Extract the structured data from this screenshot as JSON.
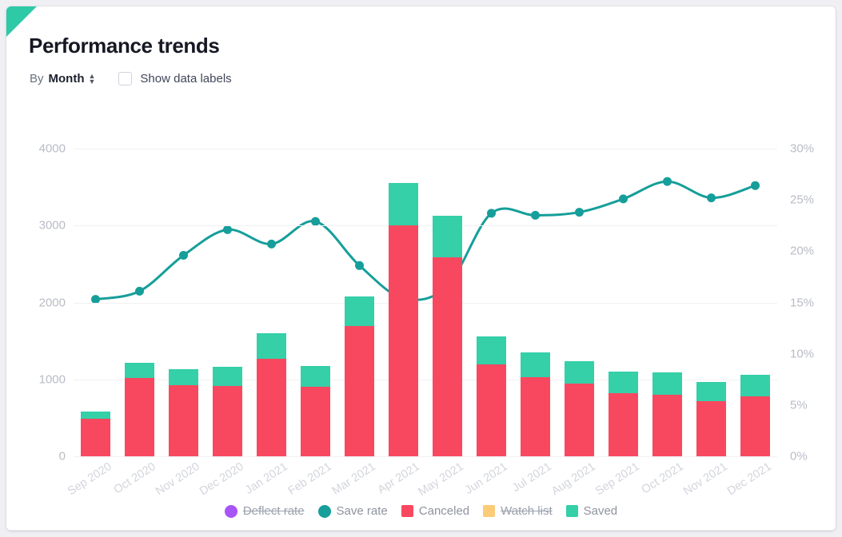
{
  "card": {
    "title": "Performance trends",
    "corner_color": "#2ec9a6"
  },
  "controls": {
    "by_label": "By",
    "granularity_value": "Month",
    "granularity_options": [
      "Month"
    ],
    "caret_icon": "chevron-updown-icon",
    "show_data_labels_label": "Show data labels",
    "show_data_labels_checked": false
  },
  "legend": {
    "items": [
      {
        "label": "Deflect rate",
        "color": "#a855f7",
        "marker": "circle",
        "disabled": true
      },
      {
        "label": "Save rate",
        "color": "#169e9a",
        "marker": "circle",
        "disabled": false
      },
      {
        "label": "Canceled",
        "color": "#f8485f",
        "marker": "square",
        "disabled": false
      },
      {
        "label": "Watch list",
        "color": "#fbcb78",
        "marker": "square",
        "disabled": true
      },
      {
        "label": "Saved",
        "color": "#35cfa8",
        "marker": "square",
        "disabled": false
      }
    ]
  },
  "chart_data": {
    "type": "bar",
    "title": "Performance trends",
    "xlabel": "",
    "ylabel": "",
    "grid": true,
    "legend_position": "bottom",
    "categories": [
      "Sep 2020",
      "Oct 2020",
      "Nov 2020",
      "Dec 2020",
      "Jan 2021",
      "Feb 2021",
      "Mar 2021",
      "Apr 2021",
      "May 2021",
      "Jun 2021",
      "Jul 2021",
      "Aug 2021",
      "Sep 2021",
      "Oct 2021",
      "Nov 2021",
      "Dec 2021"
    ],
    "left_axis": {
      "label": "",
      "ticks": [
        0,
        1000,
        2000,
        3000,
        4000
      ],
      "tick_labels": [
        "0",
        "1000",
        "2000",
        "3000",
        "4000"
      ],
      "ylim": [
        0,
        4000
      ]
    },
    "right_axis": {
      "label": "",
      "ticks": [
        0,
        5,
        10,
        15,
        20,
        25,
        30
      ],
      "tick_labels": [
        "0%",
        "5%",
        "10%",
        "15%",
        "20%",
        "25%",
        "30%"
      ],
      "ylim": [
        0,
        30
      ]
    },
    "stacked": true,
    "series": [
      {
        "name": "Canceled",
        "type": "bar",
        "axis": "left",
        "color": "#f8485f",
        "values": [
          490,
          1020,
          920,
          910,
          1270,
          900,
          1690,
          3000,
          2590,
          1200,
          1030,
          950,
          820,
          800,
          720,
          780
        ]
      },
      {
        "name": "Saved",
        "type": "bar",
        "axis": "left",
        "color": "#35cfa8",
        "values": [
          90,
          200,
          215,
          250,
          330,
          270,
          390,
          555,
          540,
          360,
          320,
          290,
          280,
          290,
          245,
          280
        ]
      },
      {
        "name": "Save rate",
        "type": "line",
        "axis": "right",
        "color": "#169e9a",
        "values": [
          15.3,
          16.1,
          19.6,
          22.1,
          20.7,
          22.9,
          18.6,
          15.4,
          16.6,
          23.7,
          23.5,
          23.8,
          25.1,
          26.8,
          25.2,
          26.4
        ]
      },
      {
        "name": "Deflect rate",
        "type": "line",
        "axis": "right",
        "color": "#a855f7",
        "hidden": true,
        "values": []
      },
      {
        "name": "Watch list",
        "type": "bar",
        "axis": "left",
        "color": "#fbcb78",
        "hidden": true,
        "values": []
      }
    ]
  }
}
